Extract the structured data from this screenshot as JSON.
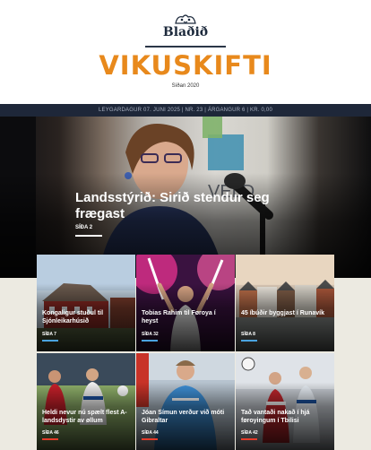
{
  "masthead": {
    "logo_text": "Blaðið",
    "title": "VIKUSKIFTI",
    "since": "Síðan 2020"
  },
  "infobar": {
    "text": "LEYGARDAGUR 07. JUNI 2025 | NR. 23 | ÁRGANGUR 6 | KR. 0,00"
  },
  "hero": {
    "title": "Landsstýrið: Sirið stendur seg frægast",
    "page": "SÍÐA 2"
  },
  "articles": [
    {
      "title": "Kongaligur stuðul til Sjónleikarhúsið",
      "page": "SÍÐA 7",
      "accent": "#4aa3df"
    },
    {
      "title": "Tobias Rahim til Føroya í heyst",
      "page": "SÍÐA 32",
      "accent": "#4aa3df"
    },
    {
      "title": "45 íbúðir byggjast í Runavík",
      "page": "SÍÐA 8",
      "accent": "#4aa3df"
    },
    {
      "title": "Heldi nevur nú spælt flest A-landsdystir av øllum",
      "page": "SÍÐA 46",
      "accent": "#e53b2a"
    },
    {
      "title": "Jóan Símun verður við móti Gibraltar",
      "page": "SÍÐA 44",
      "accent": "#e53b2a"
    },
    {
      "title": "Tað vantaði nakað í hjá føroyingum í Tbilisi",
      "page": "SÍÐA 42",
      "accent": "#e53b2a"
    }
  ],
  "colors": {
    "brand_orange": "#e8891c",
    "navy": "#1e2739",
    "news_accent": "#4aa3df",
    "sport_accent": "#e53b2a"
  }
}
